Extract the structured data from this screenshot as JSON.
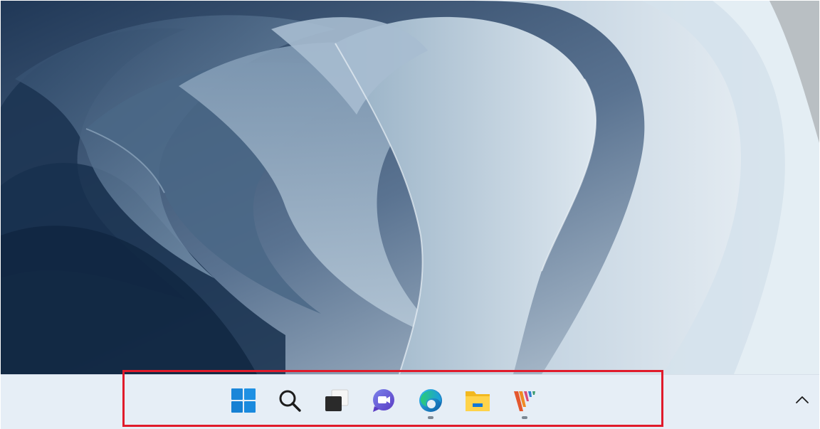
{
  "desktop": {
    "wallpaper": "windows-11-bloom-wallpaper"
  },
  "taskbar": {
    "icons": [
      {
        "name": "start-icon"
      },
      {
        "name": "search-icon"
      },
      {
        "name": "task-view-icon"
      },
      {
        "name": "chat-icon"
      },
      {
        "name": "edge-icon",
        "running": true
      },
      {
        "name": "file-explorer-icon"
      },
      {
        "name": "app-icon",
        "running": true
      }
    ],
    "overflow": {
      "name": "chevron-up-icon"
    },
    "highlight_color": "#e01b2b"
  }
}
